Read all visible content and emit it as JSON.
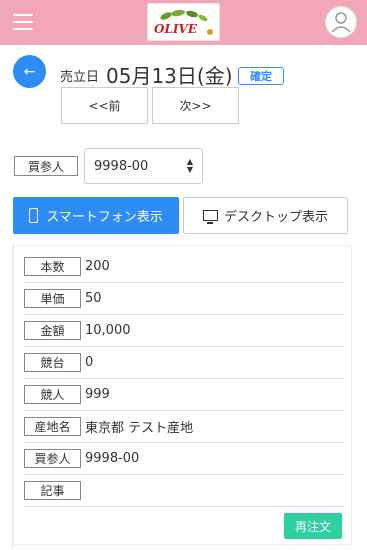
{
  "header": {
    "logo_text": "OLIVE",
    "colors": {
      "bar": "#f2a7b8",
      "accent": "#2d8df5",
      "reorder": "#2dd0a0"
    }
  },
  "sale": {
    "label": "売立日",
    "date": "05月13日(金)",
    "status": "確定",
    "prev_label": "<<前",
    "next_label": "次>>"
  },
  "buyer": {
    "label": "買参人",
    "selected": "9998-00"
  },
  "view": {
    "smartphone_label": "スマートフォン表示",
    "desktop_label": "デスクトップ表示"
  },
  "details": [
    {
      "label": "本数",
      "value": "200"
    },
    {
      "label": "単価",
      "value": "50"
    },
    {
      "label": "金額",
      "value": "10,000"
    },
    {
      "label": "競台",
      "value": "0"
    },
    {
      "label": "競人",
      "value": "999"
    },
    {
      "label": "産地名",
      "value": "東京都 テスト産地"
    },
    {
      "label": "買参人",
      "value": "9998-00"
    },
    {
      "label": "記事",
      "value": ""
    }
  ],
  "actions": {
    "reorder_label": "再注文"
  }
}
